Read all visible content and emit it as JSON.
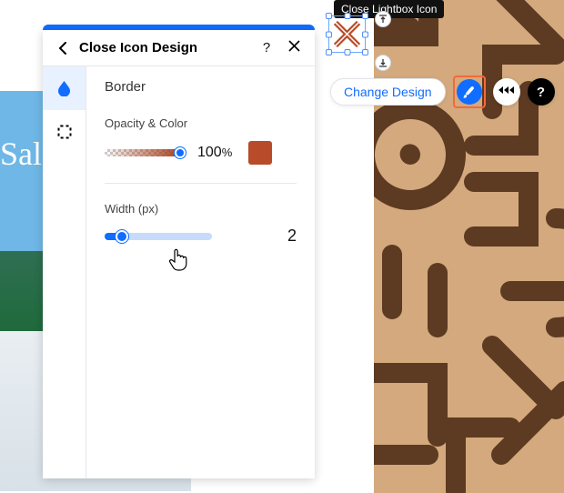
{
  "panel": {
    "title": "Close Icon Design",
    "section": "Border",
    "opacity": {
      "label": "Opacity & Color",
      "value": "100",
      "unit": "%",
      "color": "#b84b29"
    },
    "width": {
      "label": "Width (px)",
      "value": "2"
    }
  },
  "tooltip": "Close Lightbox Icon",
  "actionbar": {
    "change_label": "Change Design",
    "help_glyph": "?"
  },
  "background": {
    "sal": "Sal"
  }
}
